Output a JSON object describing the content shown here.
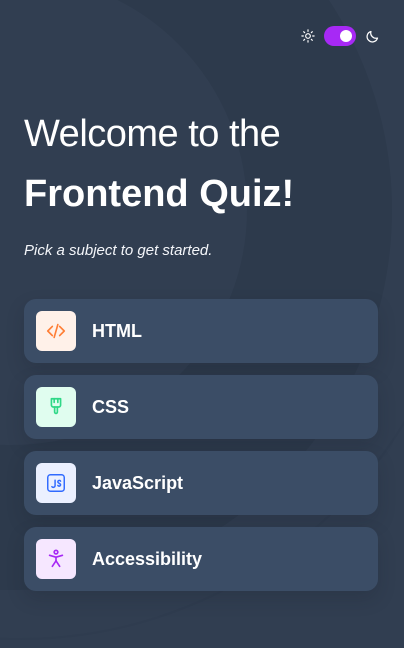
{
  "theme": {
    "sun_icon": "sun-icon",
    "moon_icon": "moon-icon",
    "accent": "#a729f5",
    "mode": "dark"
  },
  "hero": {
    "title_line1": "Welcome to the",
    "title_line2": "Frontend Quiz!",
    "subtitle": "Pick a subject to get started."
  },
  "subjects": [
    {
      "label": "HTML",
      "icon": "html-icon",
      "icon_bg": "#fff1e9",
      "icon_color": "#ff7e35"
    },
    {
      "label": "CSS",
      "icon": "css-icon",
      "icon_bg": "#e0fdef",
      "icon_color": "#2fd887"
    },
    {
      "label": "JavaScript",
      "icon": "javascript-icon",
      "icon_bg": "#ebf0ff",
      "icon_color": "#306aff"
    },
    {
      "label": "Accessibility",
      "icon": "accessibility-icon",
      "icon_bg": "#f6e7ff",
      "icon_color": "#a729f5"
    }
  ],
  "colors": {
    "background": "#313e51",
    "card": "#3b4d66"
  }
}
